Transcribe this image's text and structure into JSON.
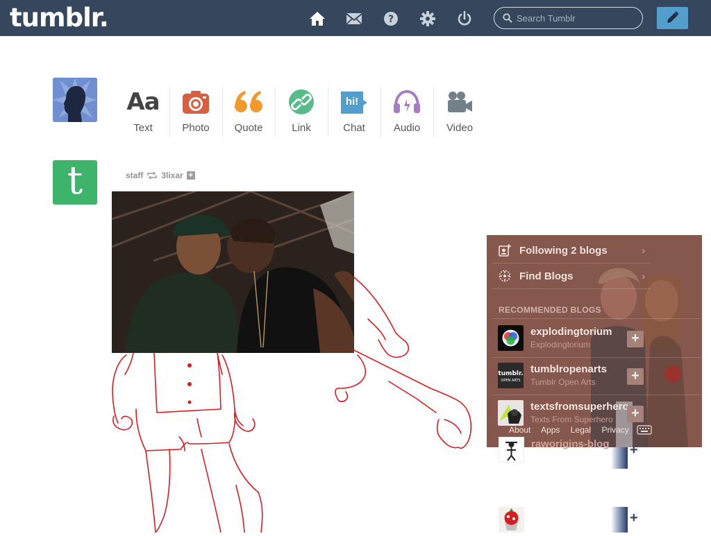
{
  "header": {
    "logo": "tumblr.",
    "nav_icons": [
      "home-icon",
      "mail-icon",
      "help-icon",
      "gear-icon",
      "power-icon"
    ],
    "search": {
      "placeholder": "Search Tumblr",
      "value": ""
    },
    "compose_icon": "pencil-icon"
  },
  "post_types": [
    {
      "label": "Text",
      "glyph": "Aa",
      "color": "#444444"
    },
    {
      "label": "Photo",
      "icon": "camera-icon",
      "color": "#d95e40"
    },
    {
      "label": "Quote",
      "glyph": "❝",
      "color": "#f2992e"
    },
    {
      "label": "Link",
      "icon": "link-icon",
      "color": "#56bc8a"
    },
    {
      "label": "Chat",
      "glyph": "hi!",
      "color": "#529ecc"
    },
    {
      "label": "Audio",
      "icon": "headphones-icon",
      "color": "#a77dc2"
    },
    {
      "label": "Video",
      "icon": "video-camera-icon",
      "color": "#748089"
    }
  ],
  "post": {
    "author": "staff",
    "reblogged_from": "3lixar",
    "avatar_letter": "t",
    "add_label": "+"
  },
  "sidebar": {
    "following": "Following 2 blogs",
    "find_blogs": "Find Blogs",
    "recommended_heading": "RECOMMENDED BLOGS",
    "recommended": [
      {
        "name": "explodingtorium",
        "title": "Explodingtorium"
      },
      {
        "name": "tumblropenarts",
        "title": "Tumblr Open Arts"
      },
      {
        "name": "textsfromsuperhero",
        "title": "Texts From Superhero"
      },
      {
        "name": "raworigins-blog",
        "title": ""
      }
    ],
    "footer_links": [
      "About",
      "Apps",
      "Legal",
      "Privacy"
    ],
    "add_label": "+"
  },
  "colors": {
    "header_bg": "#36465d",
    "accent_blue": "#529ecc",
    "sidebar_bg": "#86584e",
    "staff_green": "#3eb46b",
    "sketch_red": "#e0191f"
  }
}
